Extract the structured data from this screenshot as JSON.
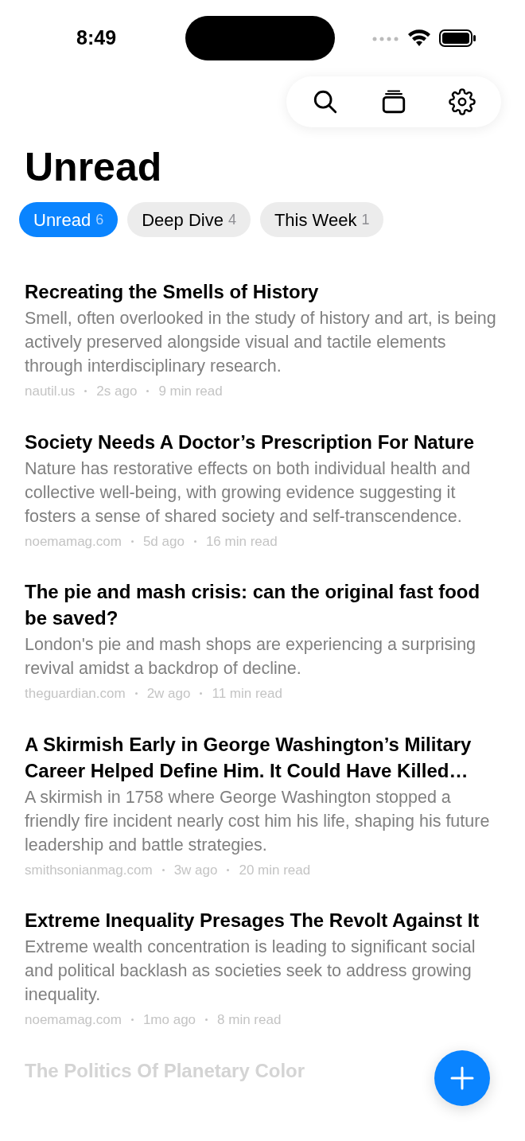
{
  "status_bar": {
    "time": "8:49"
  },
  "toolbar": {
    "buttons": [
      {
        "kind": "search"
      },
      {
        "kind": "stack"
      },
      {
        "kind": "settings"
      }
    ]
  },
  "title": "Unread",
  "tabs": [
    {
      "label": "Unread",
      "count": "6",
      "selected": true
    },
    {
      "label": "Deep Dive",
      "count": "4",
      "selected": false
    },
    {
      "label": "This Week",
      "count": "1",
      "selected": false
    }
  ],
  "articles": [
    {
      "title": "Recreating the Smells of History",
      "summary": "Smell, often overlooked in the study of history and art, is being actively preserved alongside visual and tactile elements through interdisciplinary research.",
      "source": "nautil.us",
      "age": "2s ago",
      "read_time": "9 min read",
      "faded": false
    },
    {
      "title": "Society Needs A Doctor’s Prescription For Nature",
      "summary": "Nature has restorative effects on both individual health and collective well-being, with growing evidence suggesting it fosters a sense of shared society and self-transcendence.",
      "source": "noemamag.com",
      "age": "5d ago",
      "read_time": "16 min read",
      "faded": false
    },
    {
      "title": "The pie and mash crisis: can the original fast food be saved?",
      "summary": "London's pie and mash shops are experiencing a surprising revival amidst a backdrop of decline.",
      "source": "theguardian.com",
      "age": "2w ago",
      "read_time": "11 min read",
      "faded": false
    },
    {
      "title": "A Skirmish Early in George Washington’s Military Career Helped Define Him. It Could Have Killed…",
      "summary": "A skirmish in 1758 where George Washington stopped a friendly fire incident nearly cost him his life, shaping his future leadership and battle strategies.",
      "source": "smithsonianmag.com",
      "age": "3w ago",
      "read_time": "20 min read",
      "faded": false
    },
    {
      "title": "Extreme Inequality Presages The Revolt Against It",
      "summary": "Extreme wealth concentration is leading to significant social and political backlash as societies seek to address growing inequality.",
      "source": "noemamag.com",
      "age": "1mo ago",
      "read_time": "8 min read",
      "faded": false
    },
    {
      "title": "The Politics Of Planetary Color",
      "faded": true
    }
  ]
}
